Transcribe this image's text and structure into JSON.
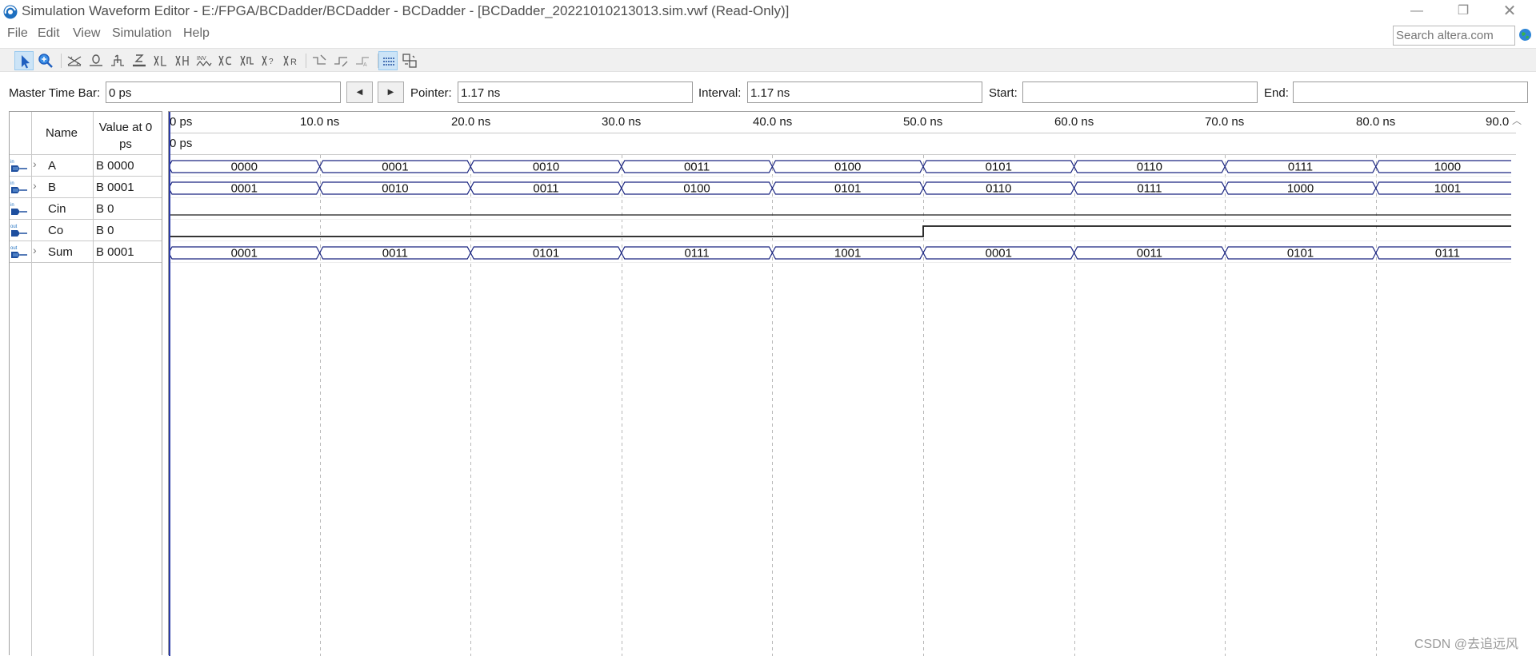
{
  "window": {
    "title": "Simulation Waveform Editor - E:/FPGA/BCDadder/BCDadder - BCDadder - [BCDadder_20221010213013.sim.vwf (Read-Only)]",
    "controls": {
      "minimize": "—",
      "maximize": "❐",
      "close": "✕"
    }
  },
  "menu": {
    "file": "File",
    "edit": "Edit",
    "view": "View",
    "simulation": "Simulation",
    "help": "Help"
  },
  "search": {
    "placeholder": "Search altera.com"
  },
  "toolbar": {
    "icons": [
      "selection-tool-icon",
      "zoom-tool-icon",
      "force-unknown-icon",
      "force-low-icon",
      "force-high-icon",
      "force-high-impedance-icon",
      "force-weak-low-icon",
      "force-weak-high-icon",
      "invert-icon",
      "count-value-icon",
      "clock-icon",
      "random-values-icon",
      "dont-care-icon",
      "arbitrary-value-icon",
      "snap-to-grid-icon",
      "snap-left-icon",
      "snap-right-icon",
      "grid-icon",
      "settings-icon"
    ]
  },
  "timebar": {
    "master_label": "Master Time Bar:",
    "master_value": "0 ps",
    "prev": "◀",
    "next": "▶",
    "pointer_label": "Pointer:",
    "pointer_value": "1.17 ns",
    "interval_label": "Interval:",
    "interval_value": "1.17 ns",
    "start_label": "Start:",
    "start_value": "",
    "end_label": "End:",
    "end_value": ""
  },
  "table": {
    "name_header": "Name",
    "value_header": "Value at 0 ps",
    "signals": [
      {
        "name": "A",
        "value": "B 0000",
        "direction": "in",
        "expandable": true
      },
      {
        "name": "B",
        "value": "B 0001",
        "direction": "in",
        "expandable": true
      },
      {
        "name": "Cin",
        "value": "B 0",
        "direction": "in",
        "expandable": false
      },
      {
        "name": "Co",
        "value": "B 0",
        "direction": "out",
        "expandable": false
      },
      {
        "name": "Sum",
        "value": "B 0001",
        "direction": "out",
        "expandable": true
      }
    ]
  },
  "ruler": {
    "labels": [
      "0 ps",
      "10.0 ns",
      "20.0 ns",
      "30.0 ns",
      "40.0 ns",
      "50.0 ns",
      "60.0 ns",
      "70.0 ns",
      "80.0 ns",
      "90.0"
    ],
    "pointer_time": "0 ps"
  },
  "waves": {
    "ns_per_segment": 10,
    "visible_end_ns": 88.8,
    "bus": [
      {
        "name": "A",
        "values": [
          "0000",
          "0001",
          "0010",
          "0011",
          "0100",
          "0101",
          "0110",
          "0111",
          "1000"
        ]
      },
      {
        "name": "B",
        "values": [
          "0001",
          "0010",
          "0011",
          "0100",
          "0101",
          "0110",
          "0111",
          "1000",
          "1001"
        ]
      },
      {
        "name": "Sum",
        "values": [
          "0001",
          "0011",
          "0101",
          "0111",
          "1001",
          "0001",
          "0011",
          "0101",
          "0111"
        ]
      }
    ],
    "bits": [
      {
        "name": "Cin",
        "levels": [
          0,
          0,
          0,
          0,
          0,
          0,
          0,
          0,
          0
        ]
      },
      {
        "name": "Co",
        "levels": [
          0,
          0,
          0,
          0,
          0,
          1,
          1,
          1,
          1
        ]
      }
    ],
    "colors": {
      "bus_line": "#1a2580",
      "bit_line": "#1a1a1a",
      "cursor": "#2a3aa8"
    }
  },
  "watermark": "CSDN @去追远风"
}
